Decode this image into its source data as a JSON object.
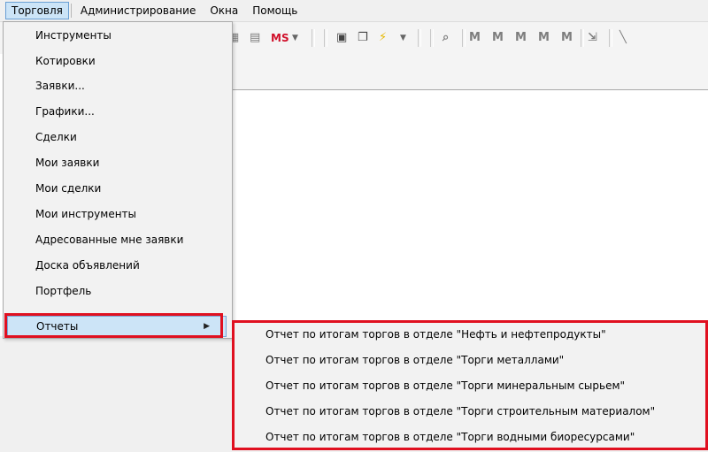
{
  "menubar": {
    "items": [
      "Торговля",
      "Администрирование",
      "Окна",
      "Помощь"
    ]
  },
  "toolbar": {
    "ms_label": "MS",
    "icons": [
      "table-icon",
      "print-icon",
      "ms-icon",
      "dropdown-icon",
      "calculator-icon",
      "copy-icon",
      "lightning-icon",
      "dropdown-icon",
      "search-icon",
      "m1-icon",
      "m2-icon",
      "m3-icon",
      "m4-icon",
      "m5-icon",
      "export-icon"
    ]
  },
  "menu": {
    "items": [
      "Инструменты",
      "Котировки",
      "Заявки...",
      "Графики...",
      "Сделки",
      "Мои заявки",
      "Мои сделки",
      "Мои инструменты",
      "Адресованные мне заявки",
      "Доска объявлений",
      "Портфель",
      "Отчеты"
    ],
    "highlighted_index": 11
  },
  "submenu": {
    "items": [
      "Отчет по итогам торгов в отделе \"Нефть и нефтепродукты\"",
      "Отчет по итогам торгов в отделе \"Торги металлами\"",
      "Отчет по итогам торгов в отделе \"Торги минеральным сырьем\"",
      "Отчет по итогам торгов в отделе \"Торги строительным материалом\"",
      "Отчет по итогам торгов в отделе \"Торги водными биоресурсами\""
    ]
  },
  "colors": {
    "highlight": "#cce4f7",
    "annotation_red": "#e01020",
    "menu_bg": "#f2f2f2"
  }
}
